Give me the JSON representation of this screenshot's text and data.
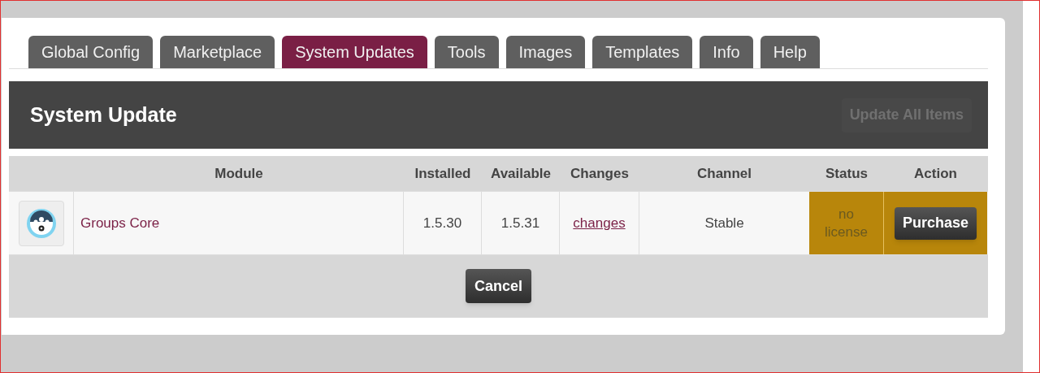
{
  "tabs": [
    {
      "label": "Global Config",
      "selected": false
    },
    {
      "label": "Marketplace",
      "selected": false
    },
    {
      "label": "System Updates",
      "selected": true
    },
    {
      "label": "Tools",
      "selected": false
    },
    {
      "label": "Images",
      "selected": false
    },
    {
      "label": "Templates",
      "selected": false
    },
    {
      "label": "Info",
      "selected": false
    },
    {
      "label": "Help",
      "selected": false
    }
  ],
  "header": {
    "title": "System Update",
    "update_all_button": {
      "label": "Update All Items",
      "disabled": true
    }
  },
  "table": {
    "columns": [
      "Module",
      "Installed",
      "Available",
      "Changes",
      "Channel",
      "Status",
      "Action"
    ],
    "rows": [
      {
        "module": "Groups Core",
        "installed": "1.5.30",
        "available": "1.5.31",
        "changes": "changes",
        "channel": "Stable",
        "status": "no license",
        "action": "Purchase",
        "color": "#b8860b"
      }
    ]
  },
  "cancel_button": "Cancel"
}
